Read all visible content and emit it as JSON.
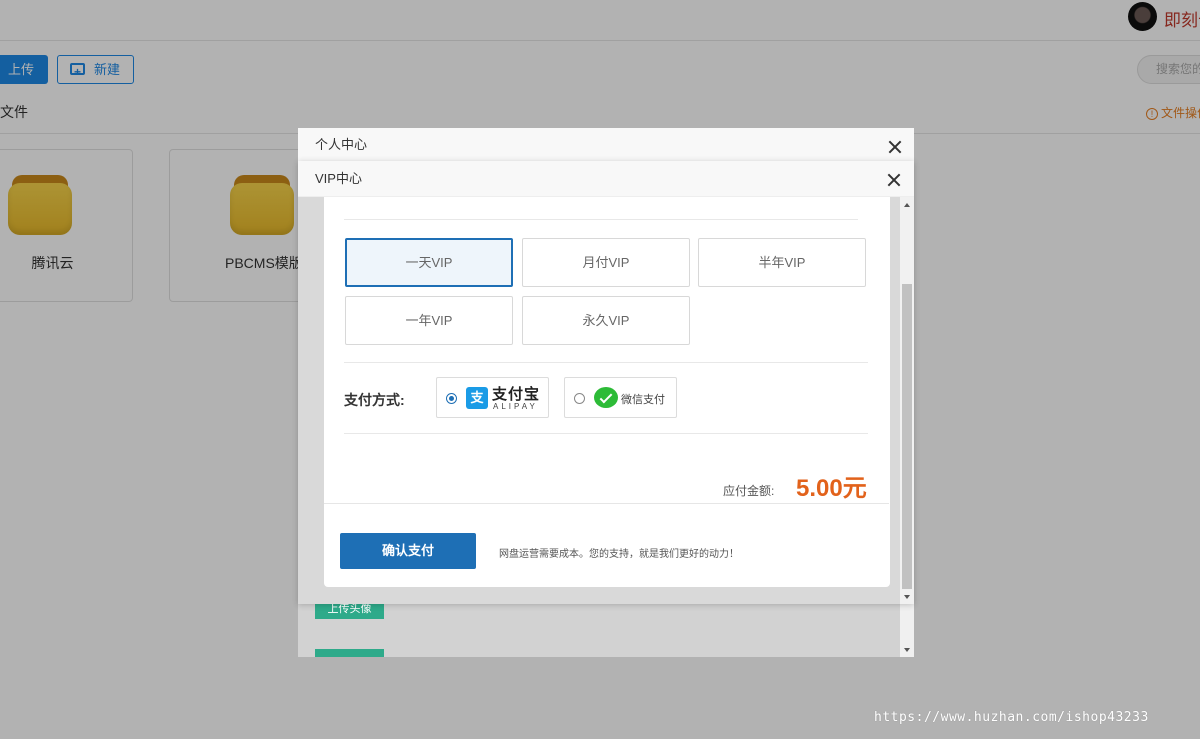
{
  "header": {
    "username": "即刻云"
  },
  "toolbar": {
    "upload_label": "上传",
    "new_label": "新建",
    "search_placeholder": "搜索您的"
  },
  "breadcrumb": {
    "label": "文件",
    "file_ops_label": "文件操作"
  },
  "folders": [
    {
      "name": "腾讯云"
    },
    {
      "name": "PBCMS模版"
    }
  ],
  "outer_dialog": {
    "title": "个人中心",
    "upload_avatar_label": "上传头像"
  },
  "vip_dialog": {
    "title": "VIP中心",
    "options": [
      {
        "label": "一天VIP",
        "selected": true
      },
      {
        "label": "月付VIP",
        "selected": false
      },
      {
        "label": "半年VIP",
        "selected": false
      },
      {
        "label": "一年VIP",
        "selected": false
      },
      {
        "label": "永久VIP",
        "selected": false
      }
    ],
    "payment_label": "支付方式:",
    "payment_methods": [
      {
        "name": "支付宝",
        "sub": "ALIPAY",
        "selected": true
      },
      {
        "name": "微信支付",
        "selected": false
      }
    ],
    "amount_label": "应付金额:",
    "amount_value": "5.00元",
    "confirm_label": "确认支付",
    "note": "网盘运营需要成本。您的支持，就是我们更好的动力！"
  },
  "watermark": "https://www.huzhan.com/ishop43233",
  "colors": {
    "primary": "#1e6fb5",
    "amount": "#e2621b",
    "accent_green": "#2eaa8a"
  }
}
